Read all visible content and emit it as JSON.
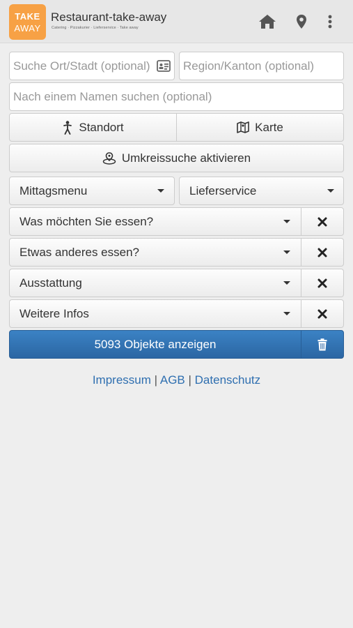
{
  "header": {
    "logo_line1": "TAKE",
    "logo_line2": "AWAY",
    "title": "Restaurant-take-away",
    "subtitle": "Catering · Pizzakurier · Lieferservice · Take away",
    "icons": [
      "home-icon",
      "map-marker-icon",
      "more-vertical-icon"
    ]
  },
  "search": {
    "location_placeholder": "Suche Ort/Stadt (optional)",
    "region_placeholder": "Region/Kanton (optional)",
    "name_placeholder": "Nach einem Namen suchen (optional)"
  },
  "buttons": {
    "standort": "Standort",
    "karte": "Karte",
    "umkreis": "Umkreissuche aktivieren"
  },
  "selects": {
    "mittagsmenu": "Mittagsmenu",
    "lieferservice": "Lieferservice"
  },
  "filters": [
    {
      "label": "Was möchten Sie essen?"
    },
    {
      "label": "Etwas anderes essen?"
    },
    {
      "label": "Ausstattung"
    },
    {
      "label": "Weitere Infos"
    }
  ],
  "results": {
    "label": "5093 Objekte anzeigen"
  },
  "footer": {
    "impressum": "Impressum",
    "agb": "AGB",
    "datenschutz": "Datenschutz",
    "separator": "|"
  },
  "colors": {
    "logo": "#f7a145",
    "primary": "#337ab7",
    "link": "#2f6fb0",
    "header_bg": "#e7e7e7",
    "page_bg": "#eeeeee"
  }
}
